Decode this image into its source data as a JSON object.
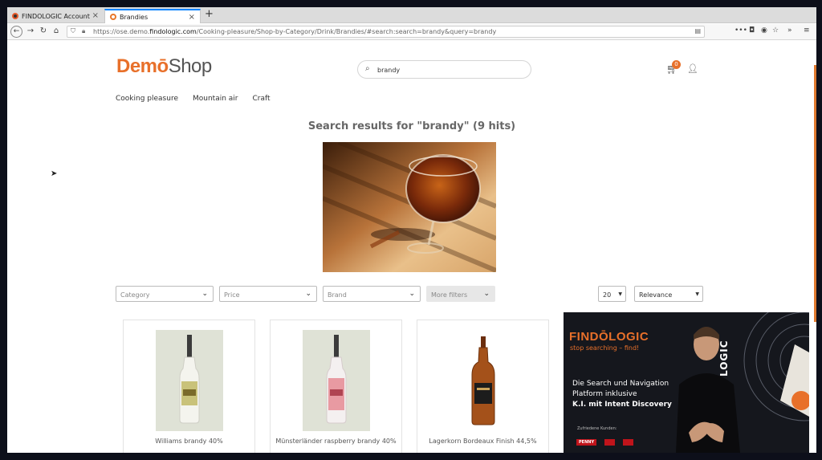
{
  "browser": {
    "tabs": [
      {
        "label": "FINDOLOGIC Account"
      },
      {
        "label": "Brandies"
      }
    ],
    "url_prefix": "https://ose.demo.",
    "url_domain": "findologic.com",
    "url_rest": "/Cooking-pleasure/Shop-by-Category/Drink/Brandies/#search:search=brandy&query=brandy"
  },
  "shop": {
    "logo_demo": "Demō",
    "logo_shop": "Shop",
    "search_value": "brandy",
    "cart_count": "0",
    "nav": [
      "Cooking pleasure",
      "Mountain air",
      "Craft"
    ],
    "heading": "Search results for \"brandy\" (9 hits)",
    "filters": {
      "category": "Category",
      "price": "Price",
      "brand": "Brand",
      "more": "More filters",
      "per_page": "20",
      "sort": "Relevance"
    },
    "products": [
      {
        "title": "Williams brandy 40%"
      },
      {
        "title": "Münsterländer raspberry brandy 40%"
      },
      {
        "title": "Lagerkorn Bordeaux Finish 44,5%"
      }
    ]
  },
  "video": {
    "logo": "FINDŌLOGIC",
    "tagline": "stop searching – find!",
    "line1": "Die Search und Navigation",
    "line2": "Platform inklusive",
    "line3": "K.I. mit Intent Discovery",
    "customers_label": "Zufriedene Kunden:",
    "customers": [
      "PENNY",
      "",
      ""
    ],
    "shirt_text": "LOGIC"
  },
  "colors": {
    "brand_orange": "#e8702a",
    "video_bg": "#15171d"
  }
}
